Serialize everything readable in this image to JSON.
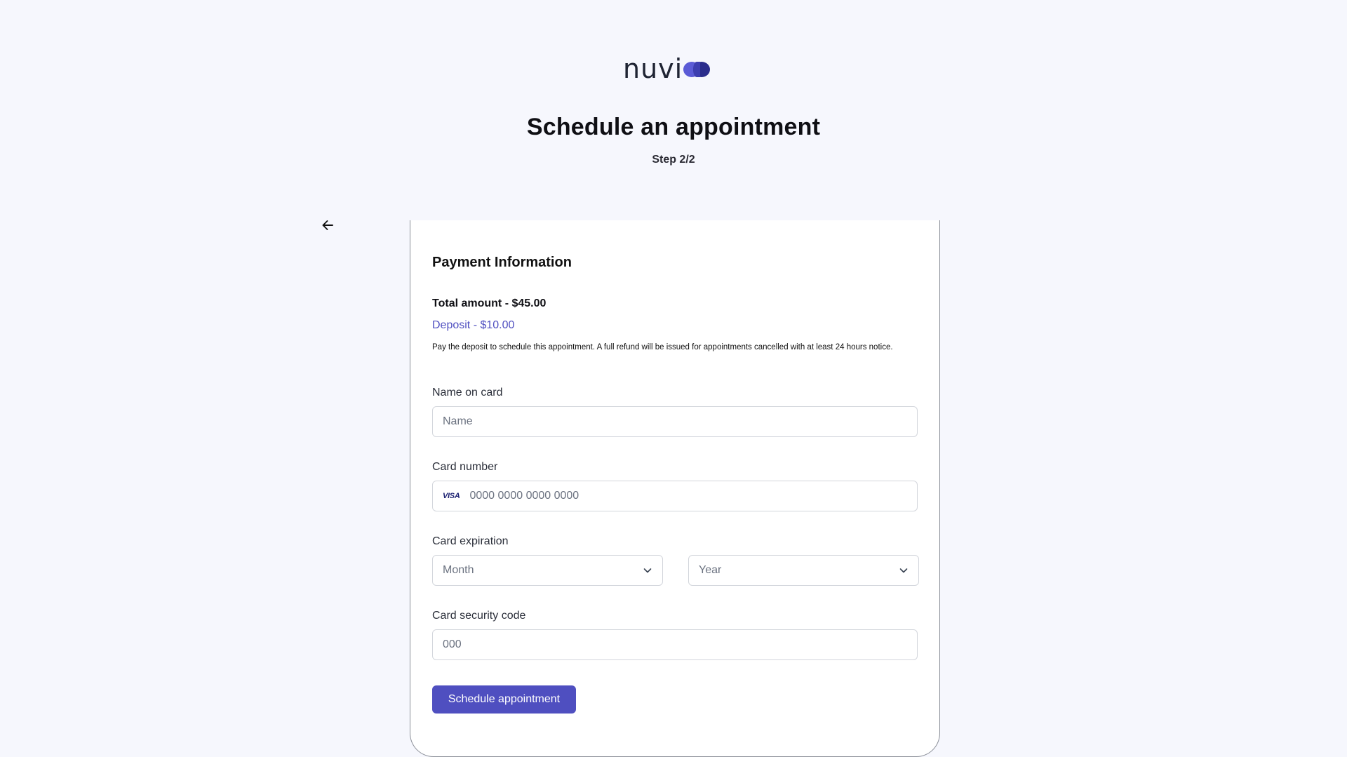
{
  "brand": {
    "logo_text": "nuvi",
    "accent_color": "#4f4fc0"
  },
  "header": {
    "title": "Schedule an appointment",
    "step": "Step 2/2"
  },
  "nav": {
    "back_icon": "arrow-left-icon"
  },
  "payment": {
    "section_title": "Payment Information",
    "total": "Total amount - $45.00",
    "deposit": "Deposit - $10.00",
    "note": "Pay the deposit to schedule this appointment. A full refund will be issued for appointments cancelled with at least 24 hours notice."
  },
  "form": {
    "name": {
      "label": "Name on card",
      "placeholder": "Name",
      "value": ""
    },
    "card_number": {
      "label": "Card number",
      "placeholder": "0000 0000 0000 0000",
      "value": "",
      "brand_icon": "visa-icon",
      "brand_text": "VISA"
    },
    "expiration": {
      "label": "Card expiration",
      "month": {
        "selected": "Month"
      },
      "year": {
        "selected": "Year"
      }
    },
    "security_code": {
      "label": "Card security code",
      "placeholder": "000",
      "value": ""
    },
    "submit_label": "Schedule appointment"
  }
}
